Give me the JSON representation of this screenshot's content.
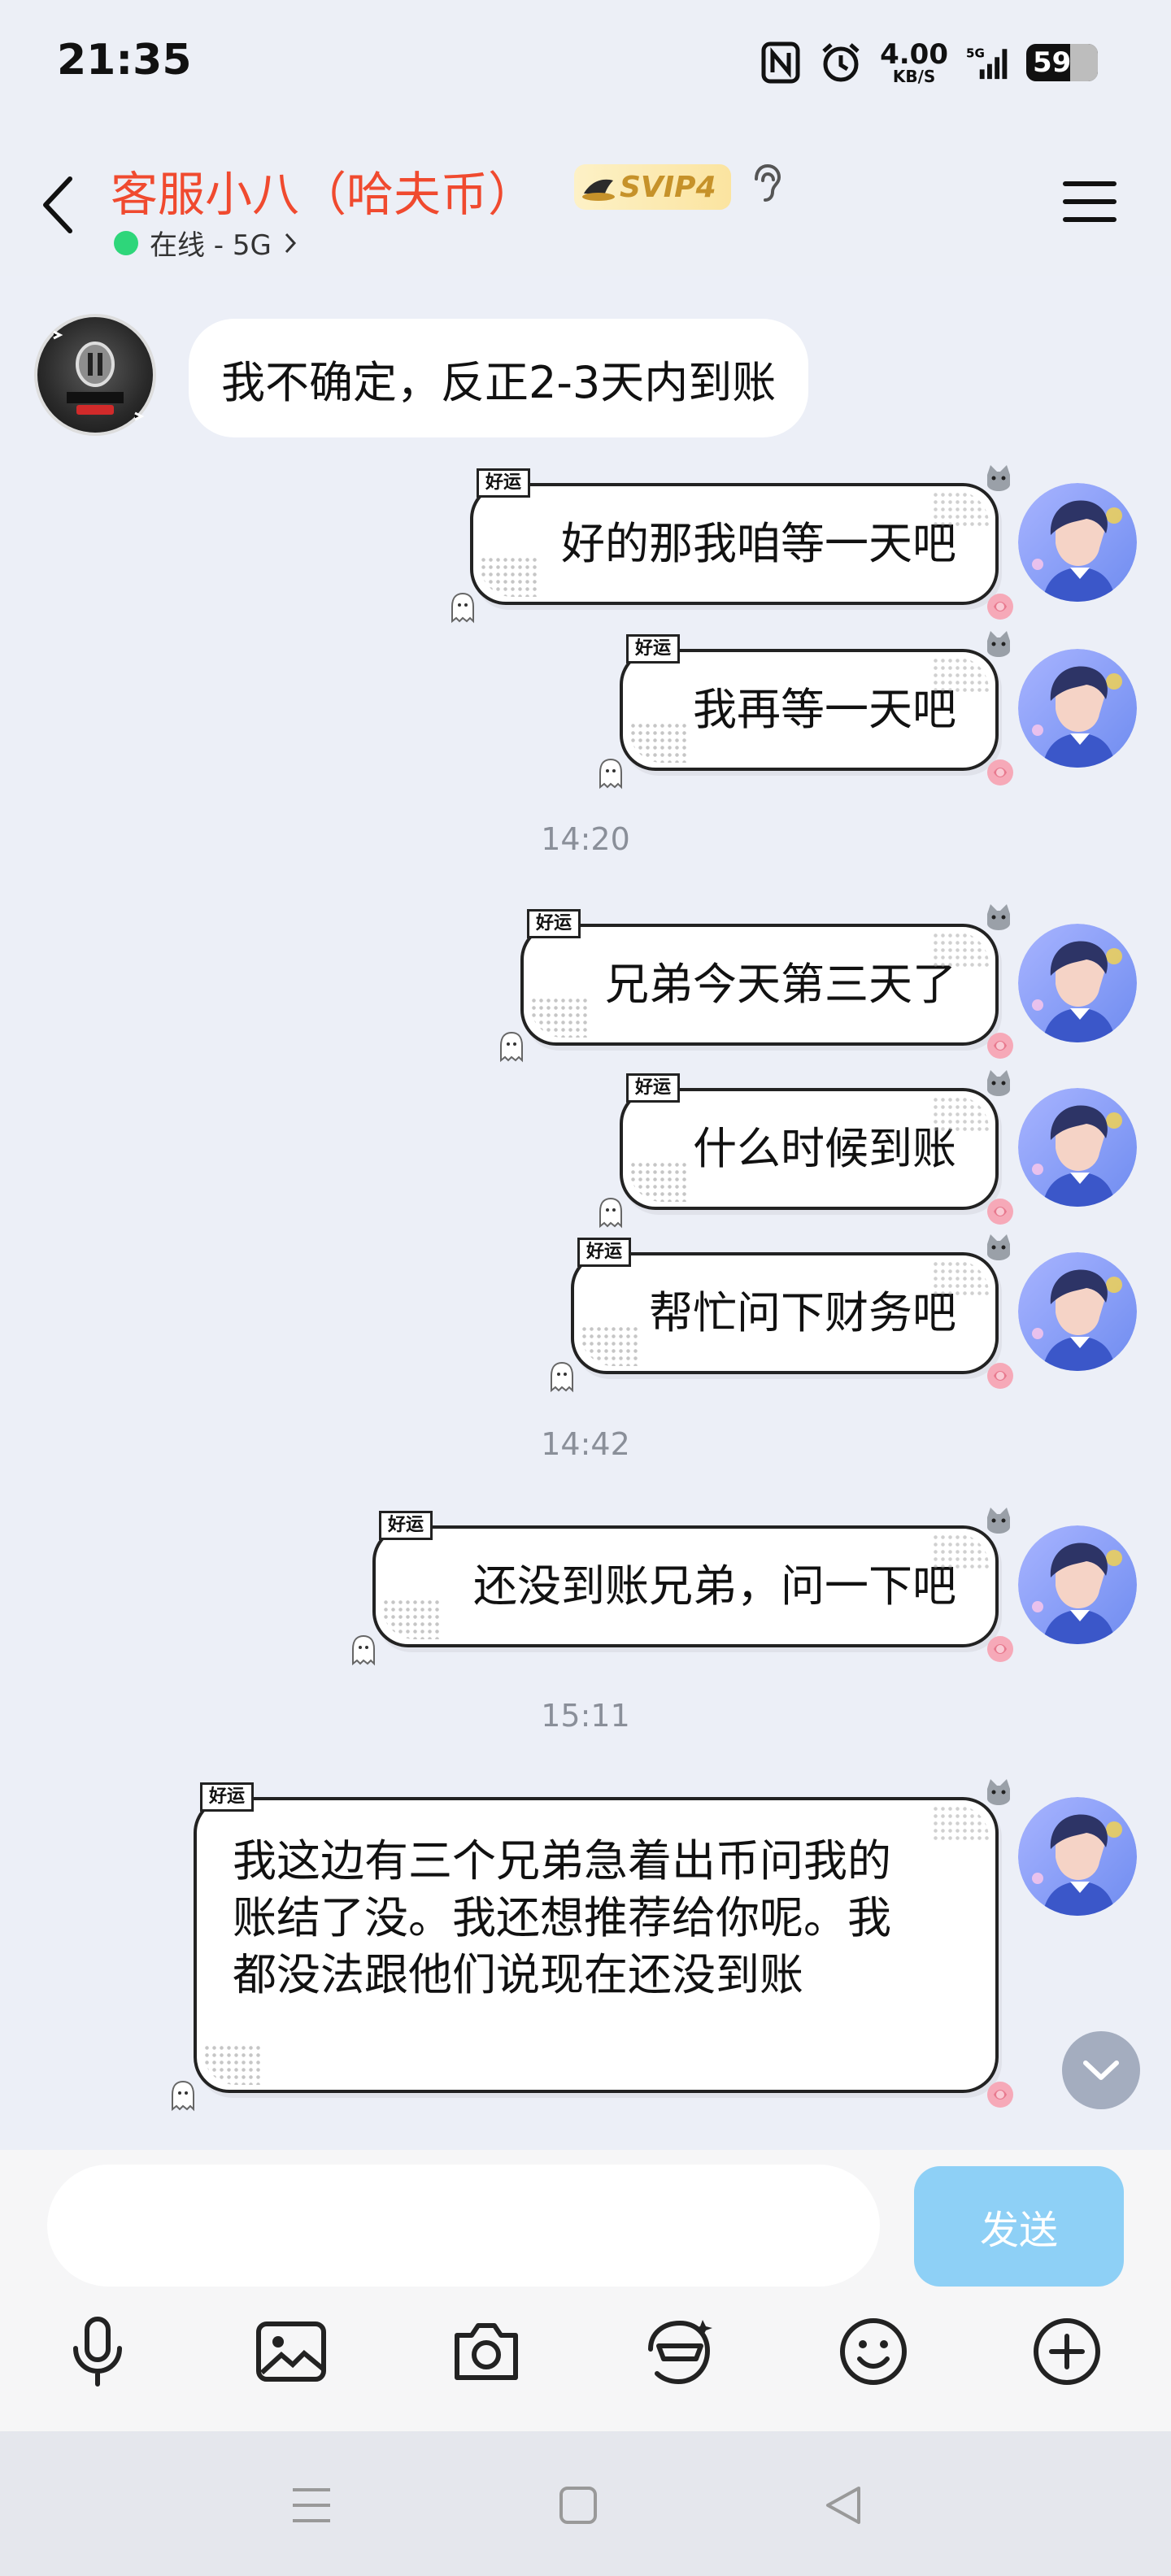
{
  "status_bar": {
    "time": "21:35",
    "net_speed_value": "4.00",
    "net_speed_unit": "KB/S",
    "network": "5G",
    "battery": "59",
    "icons": [
      "nfc-icon",
      "alarm-icon",
      "network-speed-icon",
      "signal-5g-icon",
      "battery-icon"
    ]
  },
  "header": {
    "contact_name": "客服小八（哈夫币）",
    "svip_label": "SVIP4",
    "online_status": "在线 - 5G",
    "icons": [
      "back-arrow-icon",
      "svip-hat-icon",
      "ear-icon",
      "menu-icon"
    ]
  },
  "messages": [
    {
      "sender": "cs",
      "text": "我不确定，反正2-3天内到账"
    },
    {
      "sender": "me",
      "tag": "好运",
      "text": "好的那我咱等一天吧"
    },
    {
      "sender": "me",
      "tag": "好运",
      "text": "我再等一天吧"
    },
    {
      "type": "timestamp",
      "text": "14:20"
    },
    {
      "sender": "me",
      "tag": "好运",
      "text": "兄弟今天第三天了"
    },
    {
      "sender": "me",
      "tag": "好运",
      "text": "什么时候到账"
    },
    {
      "sender": "me",
      "tag": "好运",
      "text": "帮忙问下财务吧"
    },
    {
      "type": "timestamp",
      "text": "14:42"
    },
    {
      "sender": "me",
      "tag": "好运",
      "text": "还没到账兄弟，问一下吧"
    },
    {
      "type": "timestamp",
      "text": "15:11"
    },
    {
      "sender": "me",
      "tag": "好运",
      "text": "我这边有三个兄弟急着出币问我的账结了没。我还想推荐给你呢。我都没法跟他们说现在还没到账"
    }
  ],
  "input": {
    "value": "",
    "placeholder": "",
    "send_label": "发送"
  },
  "toolbar": [
    "microphone-icon",
    "image-icon",
    "camera-icon",
    "sticker-icon",
    "emoji-icon",
    "plus-icon"
  ],
  "nav": [
    "nav-menu-icon",
    "nav-home-icon",
    "nav-back-icon"
  ],
  "colors": {
    "contact_name": "#f04a2f",
    "online_dot": "#2ed67a",
    "send_button": "#8ed0f6",
    "chat_background": "#eceff7"
  }
}
